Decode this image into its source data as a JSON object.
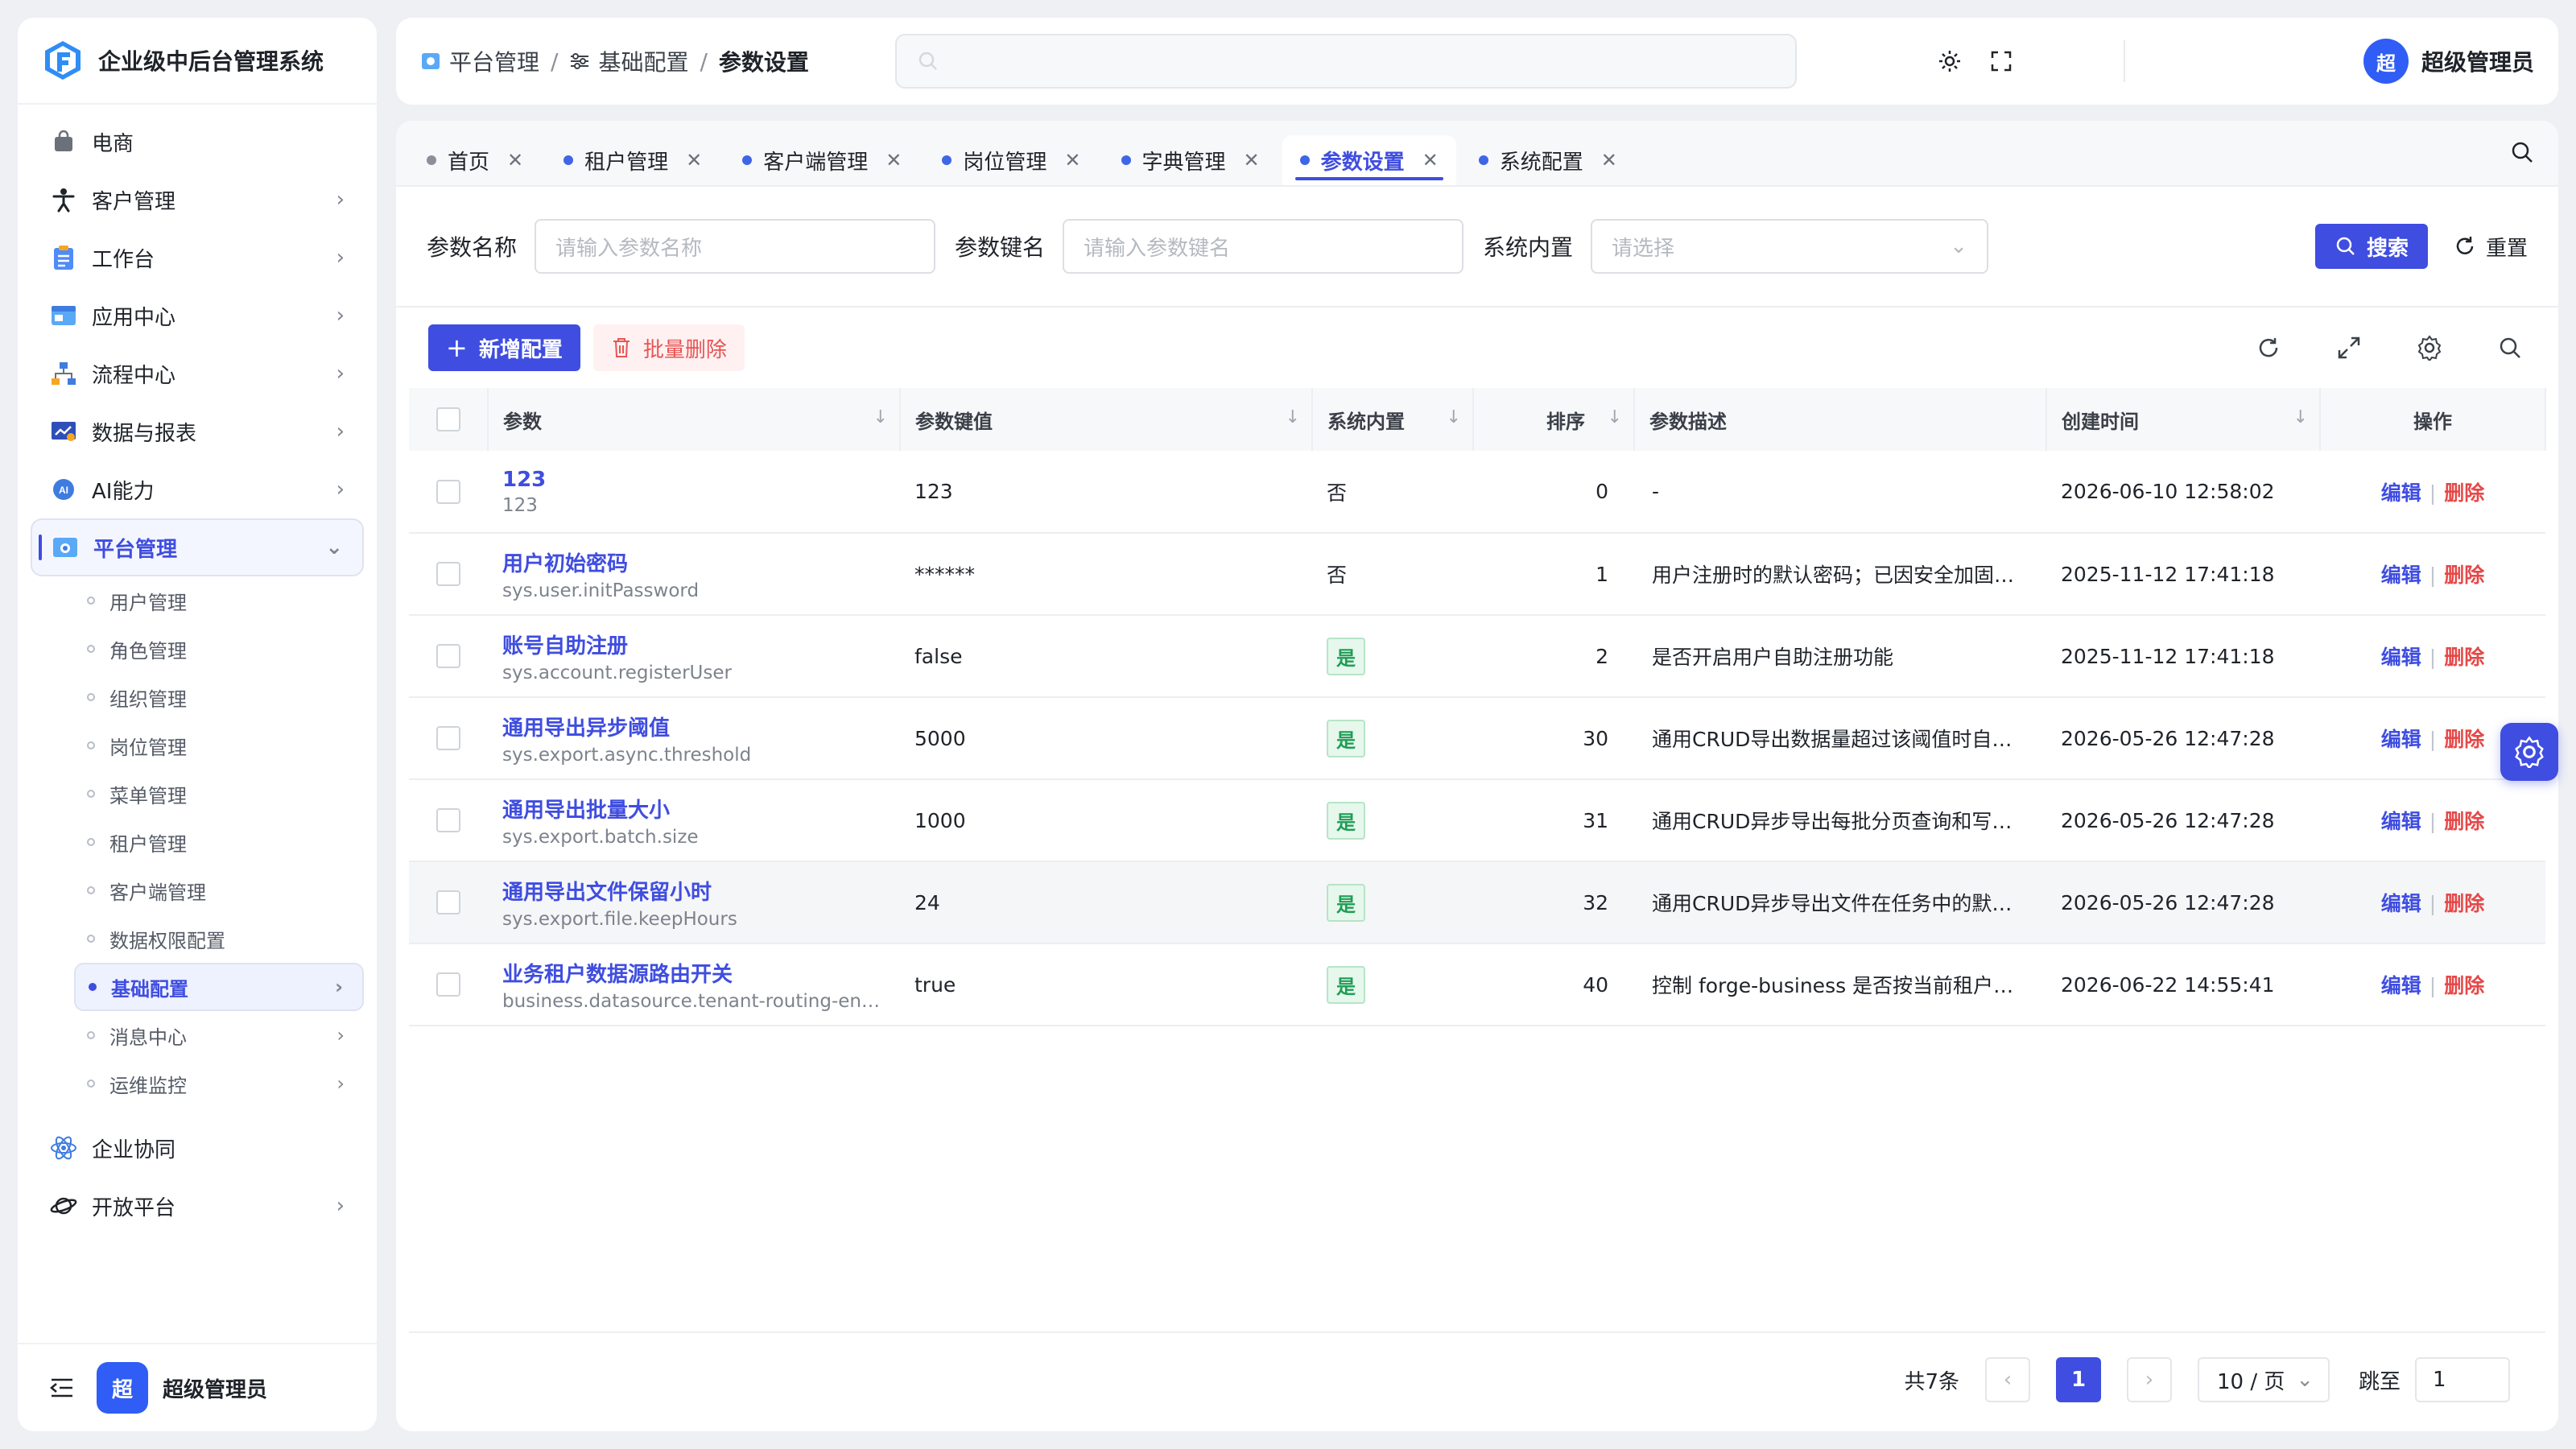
{
  "app": {
    "title": "企业级中后台管理系统"
  },
  "sidebar": {
    "items": [
      {
        "label": "电商",
        "icon": "shopping-bag-icon",
        "chevron": false
      },
      {
        "label": "客户管理",
        "icon": "person-icon",
        "chevron": true
      },
      {
        "label": "工作台",
        "icon": "clipboard-icon",
        "chevron": true
      },
      {
        "label": "应用中心",
        "icon": "app-window-icon",
        "chevron": true
      },
      {
        "label": "流程中心",
        "icon": "flow-icon",
        "chevron": true
      },
      {
        "label": "数据与报表",
        "icon": "report-icon",
        "chevron": true
      },
      {
        "label": "AI能力",
        "icon": "ai-icon",
        "chevron": true
      },
      {
        "label": "平台管理",
        "icon": "platform-icon",
        "chevron": true,
        "active": true
      }
    ],
    "sub_items": [
      "用户管理",
      "角色管理",
      "组织管理",
      "岗位管理",
      "菜单管理",
      "租户管理",
      "客户端管理",
      "数据权限配置"
    ],
    "sub_groups": [
      "基础配置",
      "消息中心",
      "运维监控"
    ],
    "bottom_items": [
      {
        "label": "企业协同",
        "icon": "atom-icon"
      },
      {
        "label": "开放平台",
        "icon": "planet-icon"
      }
    ],
    "footer": {
      "avatar": "超",
      "name": "超级管理员"
    }
  },
  "header": {
    "breadcrumb": [
      "平台管理",
      "基础配置",
      "参数设置"
    ],
    "user": {
      "avatar": "超",
      "name": "超级管理员"
    }
  },
  "tabs": [
    {
      "label": "首页",
      "active": false
    },
    {
      "label": "租户管理",
      "active": false
    },
    {
      "label": "客户端管理",
      "active": false
    },
    {
      "label": "岗位管理",
      "active": false
    },
    {
      "label": "字典管理",
      "active": false
    },
    {
      "label": "参数设置",
      "active": true
    },
    {
      "label": "系统配置",
      "active": false
    }
  ],
  "filter": {
    "name_label": "参数名称",
    "name_placeholder": "请输入参数名称",
    "key_label": "参数键名",
    "key_placeholder": "请输入参数键名",
    "builtin_label": "系统内置",
    "builtin_placeholder": "请选择",
    "search_label": "搜索",
    "reset_label": "重置"
  },
  "toolbar": {
    "add_label": "新增配置",
    "batch_delete_label": "批量删除"
  },
  "table": {
    "columns": [
      "参数",
      "参数键值",
      "系统内置",
      "排序",
      "参数描述",
      "创建时间",
      "操作"
    ],
    "rows": [
      {
        "name": "123",
        "key": "123",
        "value": "123",
        "builtin": "否",
        "sort": "0",
        "desc": "-",
        "created": "2026-06-10 12:58:02"
      },
      {
        "name": "用户初始密码",
        "key": "sys.user.initPassword",
        "value": "******",
        "builtin": "否",
        "sort": "1",
        "desc": "用户注册时的默认密码；已因安全加固停用，",
        "created": "2025-11-12 17:41:18"
      },
      {
        "name": "账号自助注册",
        "key": "sys.account.registerUser",
        "value": "false",
        "builtin": "是",
        "sort": "2",
        "desc": "是否开启用户自助注册功能",
        "created": "2025-11-12 17:41:18"
      },
      {
        "name": "通用导出异步阈值",
        "key": "sys.export.async.threshold",
        "value": "5000",
        "builtin": "是",
        "sort": "30",
        "desc": "通用CRUD导出数据量超过该阈值时自动转为",
        "created": "2026-05-26 12:47:28"
      },
      {
        "name": "通用导出批量大小",
        "key": "sys.export.batch.size",
        "value": "1000",
        "builtin": "是",
        "sort": "31",
        "desc": "通用CRUD异步导出每批分页查询和写入Excel",
        "created": "2026-05-26 12:47:28"
      },
      {
        "name": "通用导出文件保留小时",
        "key": "sys.export.file.keepHours",
        "value": "24",
        "builtin": "是",
        "sort": "32",
        "desc": "通用CRUD异步导出文件在任务中的默认保留",
        "created": "2026-05-26 12:47:28"
      },
      {
        "name": "业务租户数据源路由开关",
        "key": "business.datasource.tenant-routing-en…",
        "value": "true",
        "builtin": "是",
        "sort": "40",
        "desc": "控制 forge-business 是否按当前租户默认认证",
        "created": "2026-06-22 14:55:41"
      }
    ],
    "edit_label": "编辑",
    "delete_label": "删除"
  },
  "pagination": {
    "total": "共7条",
    "current": "1",
    "page_size": "10 / 页",
    "jump_label": "跳至",
    "jump_value": "1"
  },
  "colors": {
    "primary": "#3f4de0",
    "danger": "#e54848",
    "success": "#1f9d55"
  }
}
